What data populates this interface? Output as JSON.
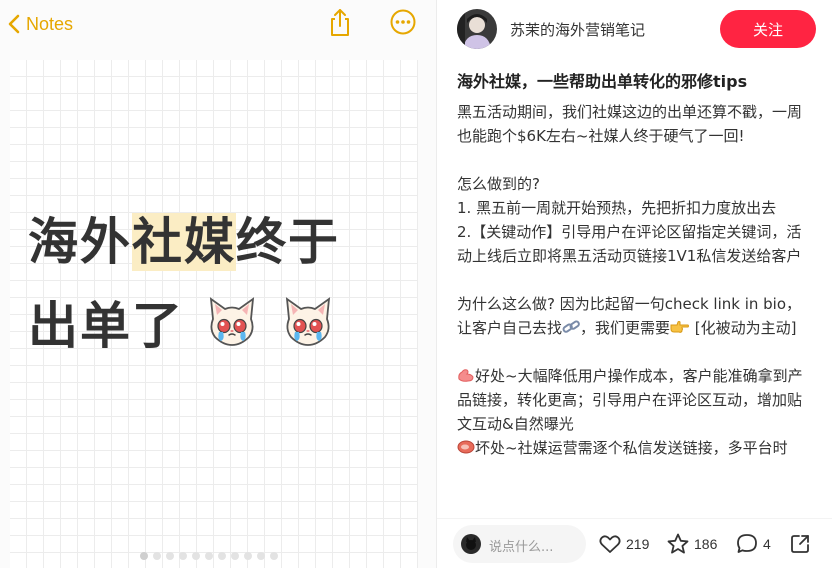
{
  "notes_app": {
    "back_label": "Notes",
    "icons": {
      "back": "chevron-left-icon",
      "share": "share-icon",
      "more": "more-circle-icon"
    },
    "accent_color": "#e6a700"
  },
  "cover": {
    "line1_a": "海外",
    "line1_highlight": "社媒",
    "line1_b": "终于",
    "line2": "出单了",
    "emoji": "crying-cat-emoji",
    "highlight_color": "#fbedc4"
  },
  "carousel": {
    "total": 11,
    "active": 1
  },
  "author": {
    "name": "苏茉的海外营销笔记",
    "follow_label": "关注",
    "follow_color": "#ff2442"
  },
  "post": {
    "title": "海外社媒，一些帮助出单转化的邪修tips",
    "intro": "黑五活动期间，我们社媒这边的出单还算不戳，一周也能跑个$6K左右~社媒人终于硬气了一回!",
    "how_heading": "怎么做到的?",
    "step1": "1. 黑五前一周就开始预热，先把折扣力度放出去",
    "step2": "2.【关键动作】引导用户在评论区留指定关键词，活动上线后立即将黑五活动页链接1V1私信发送给客户",
    "why_a": "为什么这么做? 因为比起留一句check link in bio，让客户自己去找",
    "why_b": "，我们更需要",
    "why_c": " [化被动为主动]",
    "pro_text": "好处~大幅降低用户操作成本，客户能准确拿到产品链接，转化更高；引导用户在评论区互动，增加贴文互动&自然曝光",
    "con_text": "坏处~社媒运营需逐个私信发送链接，多平台时",
    "inline_icons": [
      "link-icon",
      "pointing-hand-icon",
      "muscle-icon",
      "meat-icon"
    ]
  },
  "footer": {
    "comment_placeholder": "说点什么...",
    "likes": "219",
    "favorites": "186",
    "comments": "4",
    "icons": {
      "like": "heart-icon",
      "favorite": "star-icon",
      "comment": "comment-bubble-icon",
      "share": "share-box-icon"
    }
  }
}
